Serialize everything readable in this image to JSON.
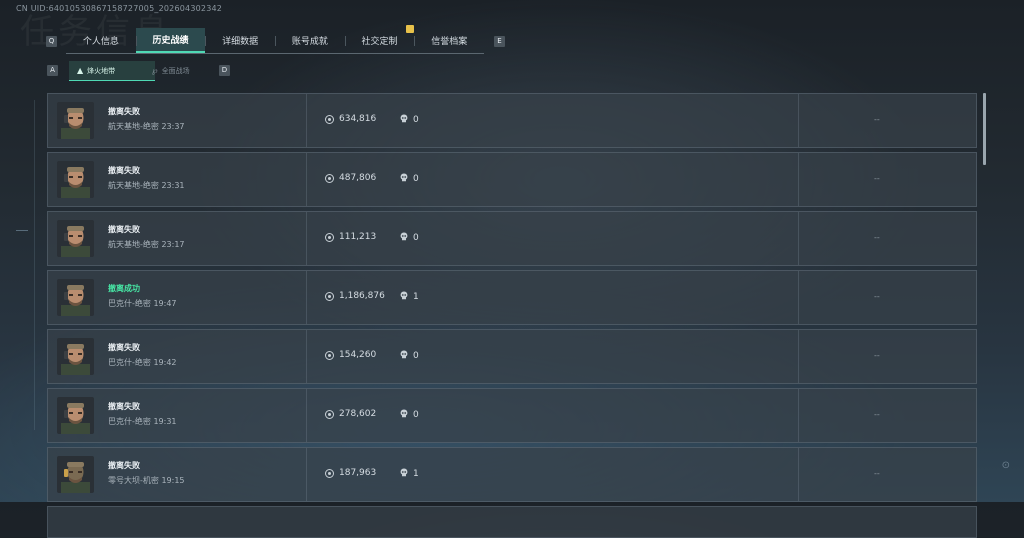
{
  "header": {
    "uid": "CN UID:6401053086715872​7005_202604302342",
    "watermark": "任务信息"
  },
  "nav": {
    "left_key": "Q",
    "right_key": "E",
    "tabs": [
      "个人信息",
      "历史战绩",
      "详细数据",
      "账号成就",
      "社交定制",
      "信誉档案"
    ],
    "active_tab": "历史战绩"
  },
  "subnav": {
    "left_key": "A",
    "right_key": "D",
    "items": [
      "烽火地带",
      "全面战场"
    ],
    "active": "烽火地带"
  },
  "records": [
    {
      "result": "撤离失败",
      "success": false,
      "map": "航天基地-绝密",
      "time": "23:37",
      "value": "634,816",
      "kills": "0",
      "extra": "--",
      "avatar": "operator-a"
    },
    {
      "result": "撤离失败",
      "success": false,
      "map": "航天基地-绝密",
      "time": "23:31",
      "value": "487,806",
      "kills": "0",
      "extra": "--",
      "avatar": "operator-a"
    },
    {
      "result": "撤离失败",
      "success": false,
      "map": "航天基地-绝密",
      "time": "23:17",
      "value": "111,213",
      "kills": "0",
      "extra": "--",
      "avatar": "operator-a"
    },
    {
      "result": "撤离成功",
      "success": true,
      "map": "巴克什-绝密",
      "time": "19:47",
      "value": "1,186,876",
      "kills": "1",
      "extra": "--",
      "avatar": "operator-a"
    },
    {
      "result": "撤离失败",
      "success": false,
      "map": "巴克什-绝密",
      "time": "19:42",
      "value": "154,260",
      "kills": "0",
      "extra": "--",
      "avatar": "operator-a"
    },
    {
      "result": "撤离失败",
      "success": false,
      "map": "巴克什-绝密",
      "time": "19:31",
      "value": "278,602",
      "kills": "0",
      "extra": "--",
      "avatar": "operator-a"
    },
    {
      "result": "撤离失败",
      "success": false,
      "map": "零号大坝-机密",
      "time": "19:15",
      "value": "187,963",
      "kills": "1",
      "extra": "--",
      "avatar": "operator-b"
    }
  ],
  "colors": {
    "accent": "#4fd9b4",
    "success": "#47e6a5",
    "row_bg": "#37414a"
  },
  "icons": {
    "value": "coin-icon",
    "kills": "skull-icon"
  }
}
